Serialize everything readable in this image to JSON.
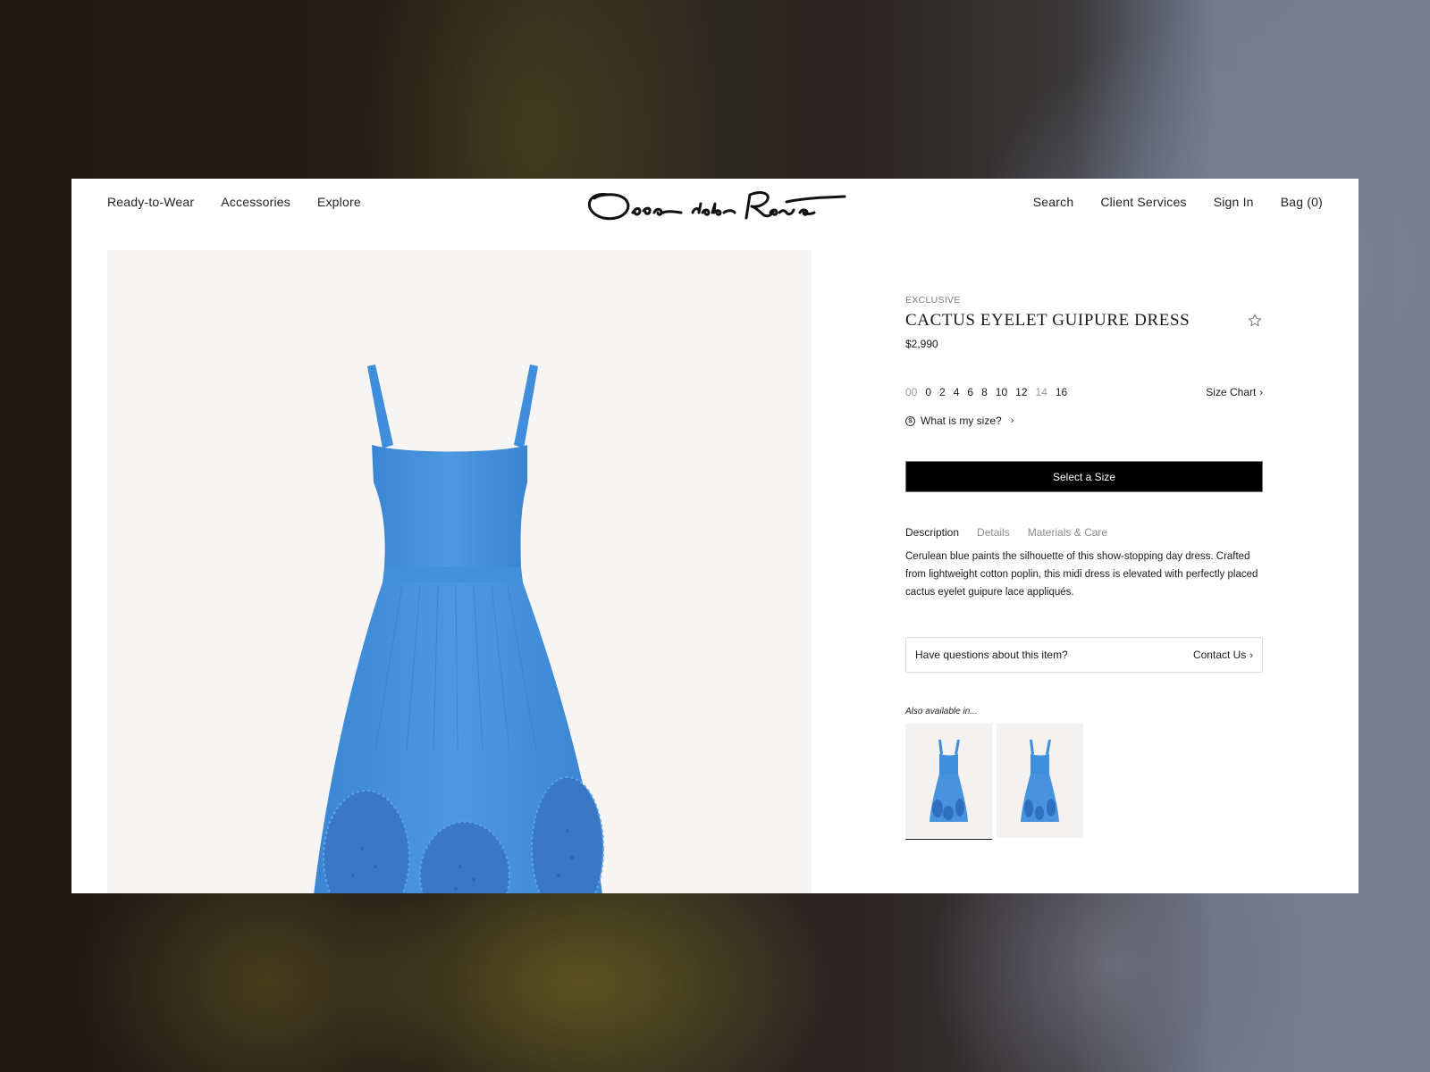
{
  "nav": {
    "left": [
      {
        "label": "Ready-to-Wear"
      },
      {
        "label": "Accessories"
      },
      {
        "label": "Explore"
      }
    ],
    "logo_alt": "Oscar de la Renta",
    "right": [
      {
        "label": "Search"
      },
      {
        "label": "Client Services"
      },
      {
        "label": "Sign In"
      },
      {
        "label": "Bag (0)"
      }
    ]
  },
  "product": {
    "badge": "EXCLUSIVE",
    "title": "CACTUS EYELET GUIPURE DRESS",
    "price": "$2,990",
    "favorite_icon": "star-outline-icon",
    "sizes": [
      {
        "label": "00",
        "available": false
      },
      {
        "label": "0",
        "available": true
      },
      {
        "label": "2",
        "available": true
      },
      {
        "label": "4",
        "available": true
      },
      {
        "label": "6",
        "available": true
      },
      {
        "label": "8",
        "available": true
      },
      {
        "label": "10",
        "available": true
      },
      {
        "label": "12",
        "available": true
      },
      {
        "label": "14",
        "available": false
      },
      {
        "label": "16",
        "available": true
      }
    ],
    "size_chart_label": "Size Chart",
    "what_is_my_size_label": "What is my size?",
    "select_size_label": "Select a Size",
    "tabs": [
      {
        "label": "Description",
        "active": true
      },
      {
        "label": "Details",
        "active": false
      },
      {
        "label": "Materials & Care",
        "active": false
      }
    ],
    "description": "Cerulean blue paints the silhouette of this show-stopping day dress. Crafted from lightweight cotton poplin, this midi dress is elevated with perfectly placed cactus eyelet guipure lace appliqués.",
    "questions_label": "Have questions about this item?",
    "contact_label": "Contact Us",
    "also_available_label": "Also available in...",
    "variants": [
      {
        "name": "Cerulean dress variant 1",
        "selected": true,
        "color": "#3f8fdc"
      },
      {
        "name": "Cerulean dress variant 2",
        "selected": false,
        "color": "#3f8fdc"
      }
    ],
    "dress_color": "#4a93dc"
  }
}
